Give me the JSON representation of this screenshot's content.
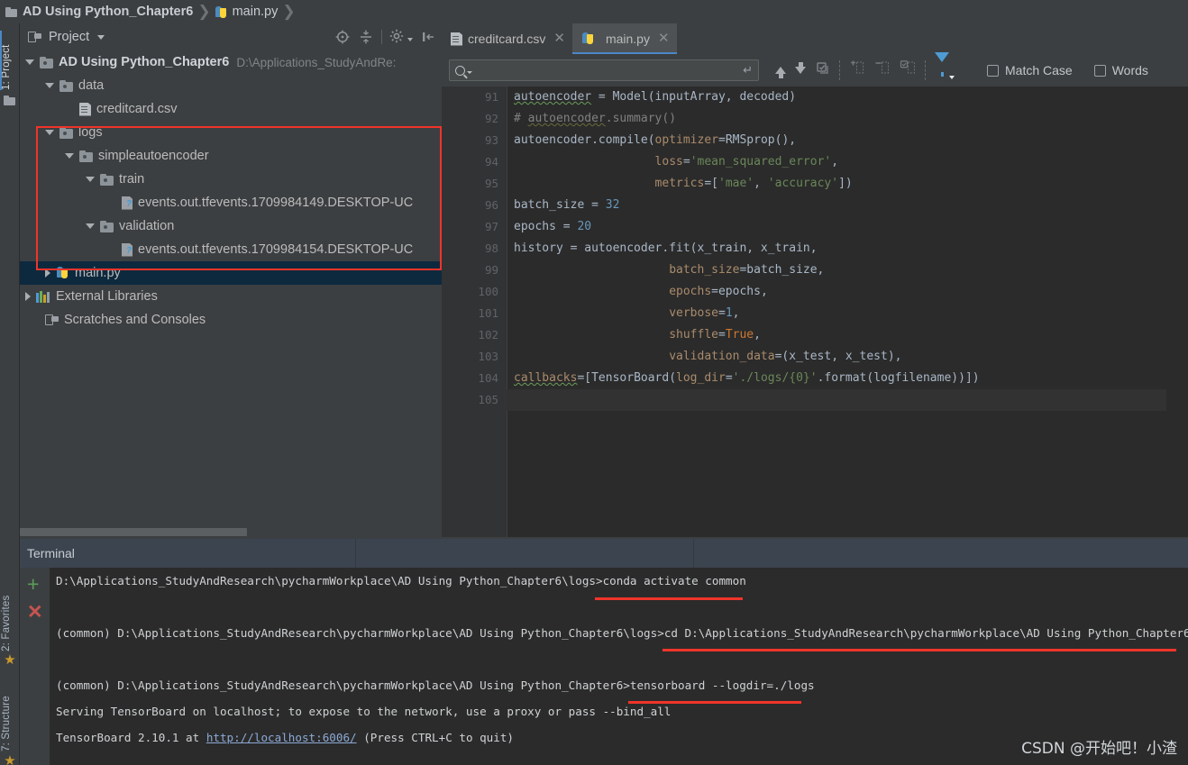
{
  "breadcrumb": {
    "project_name": "AD Using Python_Chapter6",
    "file_name": "main.py",
    "sep": "❯"
  },
  "left_strip": {
    "project_tab": "1: Project",
    "favorites_tab": "2: Favorites",
    "structure_tab": "7: Structure"
  },
  "project_panel": {
    "title": "Project",
    "root": {
      "label": "AD Using Python_Chapter6",
      "path": "D:\\Applications_StudyAndRe:"
    },
    "nodes": [
      {
        "label": "data",
        "indent": 1,
        "arrow": "down",
        "icon": "folder-icon"
      },
      {
        "label": "creditcard.csv",
        "indent": 2,
        "arrow": "none",
        "icon": "csv-file-icon"
      },
      {
        "label": "logs",
        "indent": 1,
        "arrow": "down",
        "icon": "folder-icon"
      },
      {
        "label": "simpleautoencoder",
        "indent": 2,
        "arrow": "down",
        "icon": "folder-icon"
      },
      {
        "label": "train",
        "indent": 3,
        "arrow": "down",
        "icon": "folder-icon"
      },
      {
        "label": "events.out.tfevents.1709984149.DESKTOP-UC",
        "indent": 4,
        "arrow": "none",
        "icon": "unknown-file-icon"
      },
      {
        "label": "validation",
        "indent": 3,
        "arrow": "down",
        "icon": "folder-icon"
      },
      {
        "label": "events.out.tfevents.1709984154.DESKTOP-UC",
        "indent": 4,
        "arrow": "none",
        "icon": "unknown-file-icon"
      },
      {
        "label": "main.py",
        "indent": 1,
        "arrow": "right",
        "icon": "python-file-icon",
        "selected": true
      },
      {
        "label": "External Libraries",
        "indent": 0,
        "arrow": "right",
        "icon": "libraries-icon"
      },
      {
        "label": "Scratches and Consoles",
        "indent": 0,
        "arrow": "none",
        "icon": "scratches-icon"
      }
    ],
    "toolbar_icons": [
      "locate-icon",
      "collapse-all-icon",
      "settings-gear-icon",
      "hide-panel-icon"
    ]
  },
  "editor": {
    "tabs": [
      {
        "label": "creditcard.csv",
        "icon": "csv-file-icon",
        "active": false
      },
      {
        "label": "main.py",
        "icon": "python-file-icon",
        "active": true
      }
    ],
    "find_bar": {
      "placeholder": "",
      "value": "",
      "search_icon": "search-icon",
      "enter_icon": "↵",
      "prev_icon": "arrow-up-icon",
      "next_icon": "arrow-down-icon",
      "select_all_icon": "select-all-occurrences-icon",
      "add_selection_icon": "add-selection-icon",
      "remove_selection_icon": "remove-selection-icon",
      "select_all_lines_icon": "select-all-lines-icon",
      "filter_icon": "filter-icon",
      "match_case_label": "Match Case",
      "words_label": "Words"
    },
    "first_line_number": 91,
    "lines": [
      {
        "n": 91,
        "text": "autoencoder = Model(inputArray, decoded)"
      },
      {
        "n": 92,
        "text": "# autoencoder.summary()"
      },
      {
        "n": 93,
        "text": "autoencoder.compile(optimizer=RMSprop(),"
      },
      {
        "n": 94,
        "text": "                    loss='mean_squared_error',"
      },
      {
        "n": 95,
        "text": "                    metrics=['mae', 'accuracy'])"
      },
      {
        "n": 96,
        "text": "batch_size = 32"
      },
      {
        "n": 97,
        "text": "epochs = 20"
      },
      {
        "n": 98,
        "text": "history = autoencoder.fit(x_train, x_train,"
      },
      {
        "n": 99,
        "text": "                      batch_size=batch_size,"
      },
      {
        "n": 100,
        "text": "                      epochs=epochs,"
      },
      {
        "n": 101,
        "text": "                      verbose=1,"
      },
      {
        "n": 102,
        "text": "                      shuffle=True,"
      },
      {
        "n": 103,
        "text": "                      validation_data=(x_test, x_test),"
      },
      {
        "n": 104,
        "text": "callbacks=[TensorBoard(log_dir='./logs/{0}'.format(logfilename))])"
      },
      {
        "n": 105,
        "text": ""
      }
    ]
  },
  "terminal": {
    "tab_label": "Terminal",
    "new_session_icon": "plus-icon",
    "close_session_icon": "close-icon",
    "lines": [
      {
        "prompt": "D:\\Applications_StudyAndResearch\\pycharmWorkplace\\AD Using Python_Chapter6\\logs>",
        "command": "conda activate common"
      },
      {
        "prompt": "",
        "command": ""
      },
      {
        "prompt": "(common) D:\\Applications_StudyAndResearch\\pycharmWorkplace\\AD Using Python_Chapter6\\logs>",
        "command": "cd D:\\Applications_StudyAndResearch\\pycharmWorkplace\\AD Using Python_Chapter6"
      },
      {
        "prompt": "",
        "command": ""
      },
      {
        "prompt": "(common) D:\\Applications_StudyAndResearch\\pycharmWorkplace\\AD Using Python_Chapter6>",
        "command": "tensorboard --logdir=./logs"
      },
      {
        "prompt": "",
        "command": "Serving TensorBoard on localhost; to expose to the network, use a proxy or pass --bind_all"
      },
      {
        "prompt": "",
        "command": "TensorBoard 2.10.1 at ",
        "link": "http://localhost:6006/",
        "suffix": " (Press CTRL+C to quit)"
      }
    ]
  },
  "watermark": "CSDN @开始吧！小渣",
  "colors": {
    "accent": "#4a88c7",
    "annotation_red": "#f0342a",
    "panel_bg": "#3c3f41",
    "editor_bg": "#2b2b2b",
    "terminal_tab_bg": "#3c4450",
    "selected_row": "#0d293e",
    "keyword": "#cc7832",
    "string": "#6a8759",
    "number": "#6897bb",
    "comment": "#808080",
    "param": "#aa8b6b"
  }
}
